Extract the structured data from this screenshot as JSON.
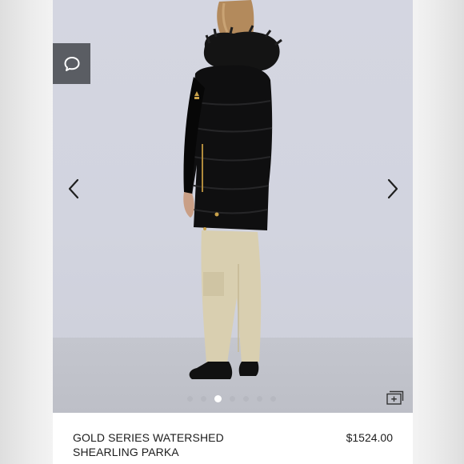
{
  "listing": {
    "title_line1": "GOLD SERIES WATERSHED",
    "title_line2": "SHEARLING PARKA",
    "price": "$1524.00"
  },
  "gallery": {
    "image_count": 7,
    "active_index": 3,
    "icons": {
      "chat": "chat-bubble-icon",
      "prev": "chevron-left-icon",
      "next": "chevron-right-icon",
      "gallery": "image-stack-icon"
    }
  },
  "colors": {
    "chat_button_bg": "#5a5d63",
    "photo_background": "#d2d4df",
    "text": "#1c1c1c"
  }
}
